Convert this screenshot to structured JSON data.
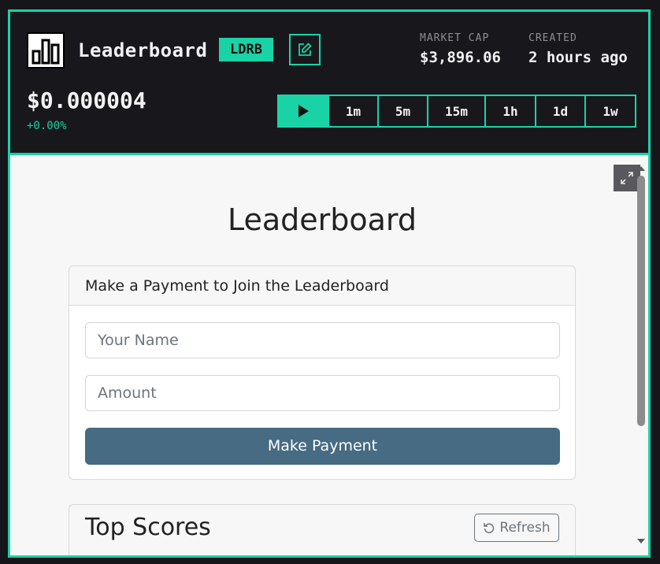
{
  "token": {
    "name": "Leaderboard",
    "ticker": "LDRB",
    "price": "$0.000004",
    "change": "+0.00%",
    "logo_icon": "bar-chart-icon"
  },
  "stats": {
    "market_cap_label": "MARKET CAP",
    "market_cap_value": "$3,896.06",
    "created_label": "CREATED",
    "created_value": "2 hours ago"
  },
  "timeframes": [
    "1m",
    "5m",
    "15m",
    "1h",
    "1d",
    "1w"
  ],
  "colors": {
    "accent": "#19d3a7",
    "button": "#466b83",
    "dark": "#18181c"
  },
  "app": {
    "heading": "Leaderboard",
    "payment_card": {
      "header": "Make a Payment to Join the Leaderboard",
      "name_placeholder": "Your Name",
      "amount_placeholder": "Amount",
      "button": "Make Payment"
    },
    "scores_card": {
      "title": "Top Scores",
      "refresh": "Refresh"
    }
  }
}
